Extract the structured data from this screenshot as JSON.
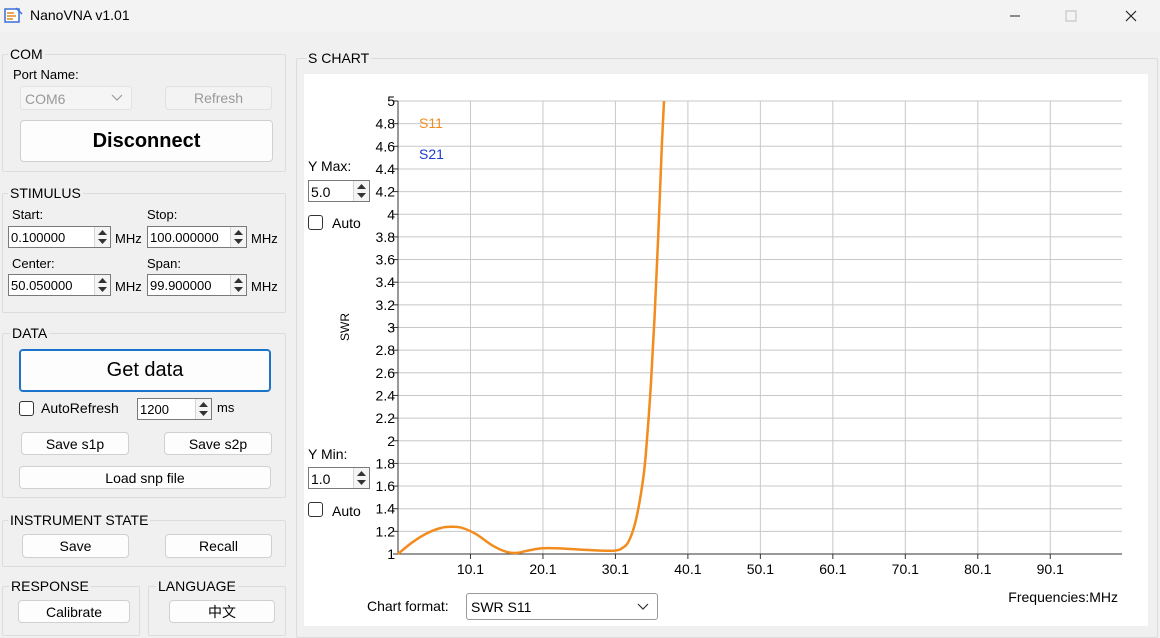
{
  "window": {
    "title": "NanoVNA v1.01"
  },
  "com": {
    "group_title": "COM",
    "port_label": "Port Name:",
    "port_value": "COM6",
    "refresh_label": "Refresh",
    "disconnect_label": "Disconnect"
  },
  "stimulus": {
    "group_title": "STIMULUS",
    "start_label": "Start:",
    "start_value": "0.100000",
    "stop_label": "Stop:",
    "stop_value": "100.000000",
    "center_label": "Center:",
    "center_value": "50.050000",
    "span_label": "Span:",
    "span_value": "99.900000",
    "unit": "MHz"
  },
  "data": {
    "group_title": "DATA",
    "get_data_label": "Get data",
    "autorefresh_label": "AutoRefresh",
    "interval_value": "1200",
    "interval_unit": "ms",
    "save_s1p_label": "Save s1p",
    "save_s2p_label": "Save s2p",
    "load_snp_label": "Load snp file"
  },
  "instrument": {
    "group_title": "INSTRUMENT STATE",
    "save_label": "Save",
    "recall_label": "Recall"
  },
  "response": {
    "group_title": "RESPONSE",
    "calibrate_label": "Calibrate"
  },
  "language": {
    "group_title": "LANGUAGE",
    "button_label": "中文"
  },
  "chart_panel": {
    "group_title": "S CHART",
    "ymax_label": "Y Max:",
    "ymax_value": "5.0",
    "ymin_label": "Y Min:",
    "ymin_value": "1.0",
    "auto_label": "Auto",
    "format_label": "Chart format:",
    "format_value": "SWR S11"
  },
  "chart_data": {
    "type": "line",
    "ylabel": "SWR",
    "xlabel": "Frequencies:MHz",
    "xlim": [
      0.1,
      100.0
    ],
    "ylim": [
      1,
      5
    ],
    "x_ticks": [
      "10.1",
      "20.1",
      "30.1",
      "40.1",
      "50.1",
      "60.1",
      "70.1",
      "80.1",
      "90.1"
    ],
    "x_tick_values": [
      10.1,
      20.1,
      30.1,
      40.1,
      50.1,
      60.1,
      70.1,
      80.1,
      90.1
    ],
    "y_ticks": [
      "5",
      "4.8",
      "4.6",
      "4.4",
      "4.2",
      "4",
      "3.8",
      "3.6",
      "3.4",
      "3.2",
      "3",
      "2.8",
      "2.6",
      "2.4",
      "2.2",
      "2",
      "1.8",
      "1.6",
      "1.4",
      "1.2",
      "1"
    ],
    "y_tick_values": [
      5,
      4.8,
      4.6,
      4.4,
      4.2,
      4,
      3.8,
      3.6,
      3.4,
      3.2,
      3,
      2.8,
      2.6,
      2.4,
      2.2,
      2,
      1.8,
      1.6,
      1.4,
      1.2,
      1
    ],
    "grid": true,
    "legend": [
      "S11",
      "S21"
    ],
    "colors": {
      "s11": "#f28c1e",
      "s21": "#1c3bd1",
      "grid": "#c8c8c8"
    },
    "series": [
      {
        "name": "S11",
        "x": [
          0.1,
          2.0,
          4.0,
          6.0,
          7.5,
          9.0,
          11.0,
          13.0,
          15.0,
          16.5,
          18.0,
          20.0,
          22.0,
          25.0,
          28.0,
          30.0,
          31.0,
          32.0,
          33.0,
          34.0,
          34.5,
          35.0,
          35.5,
          36.0,
          36.5,
          36.8
        ],
        "y": [
          1.0,
          1.1,
          1.18,
          1.23,
          1.24,
          1.23,
          1.17,
          1.08,
          1.02,
          1.01,
          1.03,
          1.05,
          1.05,
          1.04,
          1.03,
          1.03,
          1.05,
          1.12,
          1.32,
          1.7,
          2.05,
          2.5,
          3.1,
          3.8,
          4.6,
          5.0
        ]
      },
      {
        "name": "S21",
        "x": [],
        "y": []
      }
    ]
  }
}
